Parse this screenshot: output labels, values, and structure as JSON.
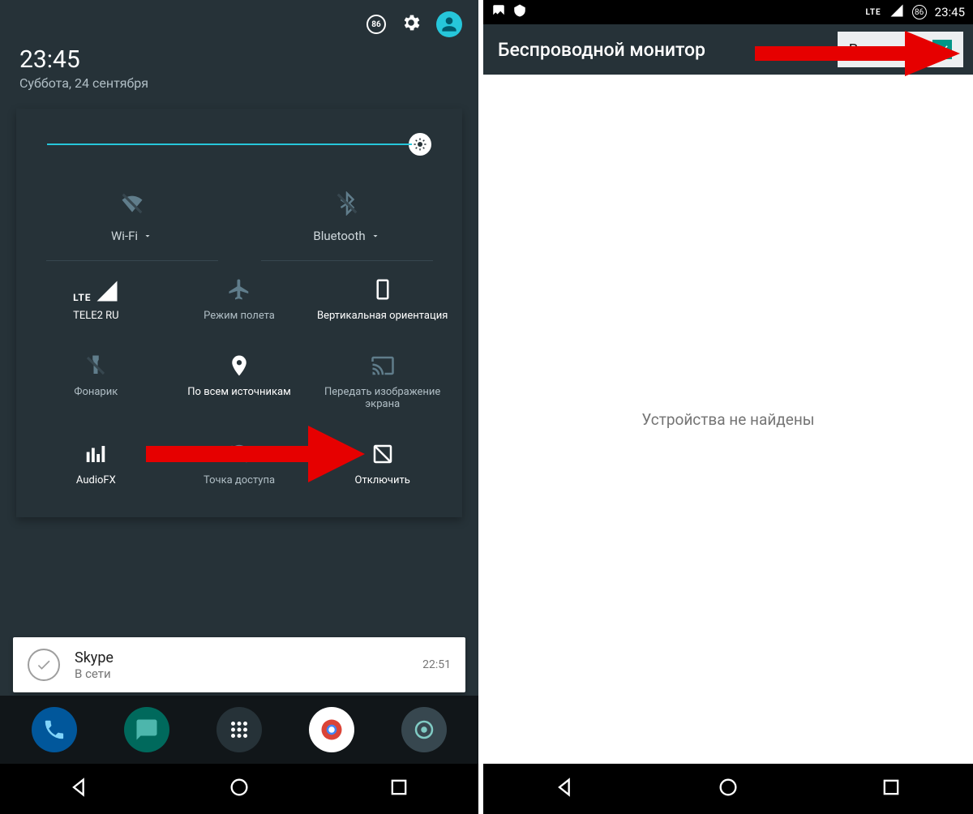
{
  "left": {
    "time": "23:45",
    "date": "Суббота, 24 сентября",
    "battery": "86",
    "tiles": {
      "wifi_dropdown": "Wi-Fi",
      "bt_dropdown": "Bluetooth",
      "signal_label": "TELE2 RU",
      "signal_lte": "LTE",
      "airplane_label": "Режим полета",
      "rotation_label": "Вертикальная ориентация",
      "flashlight_label": "Фонарик",
      "location_label": "По всем источникам",
      "cast_label": "Передать изображение экрана",
      "audiofx_label": "AudioFX",
      "hotspot_label": "Точка доступа",
      "disable_label": "Отключить"
    },
    "notification": {
      "app": "Skype",
      "subtitle": "В сети",
      "time": "22:51"
    }
  },
  "right": {
    "status_time": "23:45",
    "status_lte": "LTE",
    "status_batt": "86",
    "title": "Беспроводной монитор",
    "enable_label": "Включить",
    "empty_text": "Устройства не найдены"
  }
}
